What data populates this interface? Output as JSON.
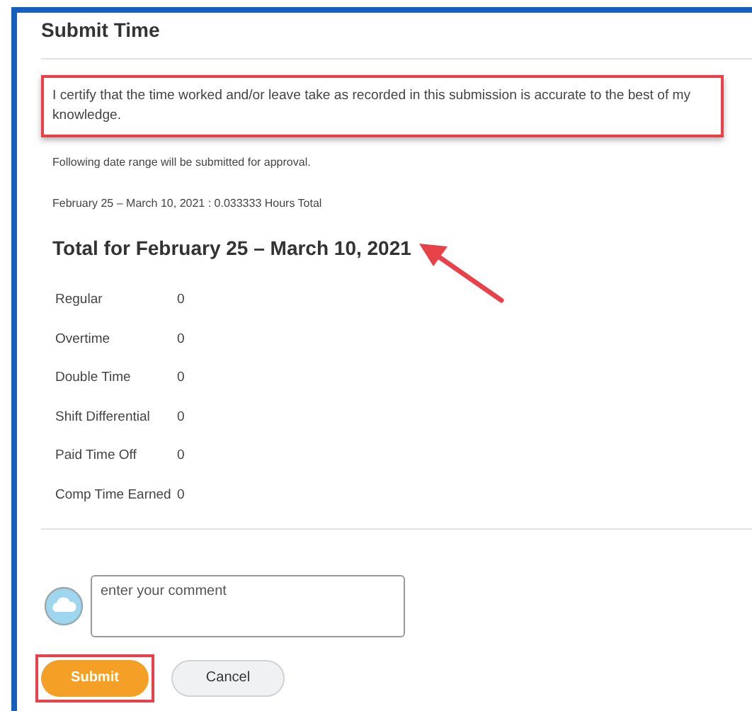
{
  "title": "Submit Time",
  "certification": {
    "text": "I certify that the time worked and/or leave take as recorded in this submission is accurate to the best of my knowledge.",
    "highlighted": true
  },
  "info": [
    "Following date range will be submitted for approval.",
    "February 25 – March 10, 2021 : 0.033333 Hours Total"
  ],
  "heading": "Total for February 25 – March 10, 2021",
  "rows": [
    {
      "label": "Regular",
      "value": "0"
    },
    {
      "label": "Overtime",
      "value": "0"
    },
    {
      "label": "Double Time",
      "value": "0"
    },
    {
      "label": "Shift Differential",
      "value": "0"
    },
    {
      "label": "Paid Time Off",
      "value": "0"
    },
    {
      "label": "Comp Time Earned",
      "value": "0"
    }
  ],
  "comment": {
    "placeholder": "enter your comment"
  },
  "buttons": [
    {
      "label": "Submit",
      "kind": "primary",
      "highlighted": true
    },
    {
      "label": "Cancel",
      "kind": "secondary",
      "highlighted": false
    }
  ]
}
